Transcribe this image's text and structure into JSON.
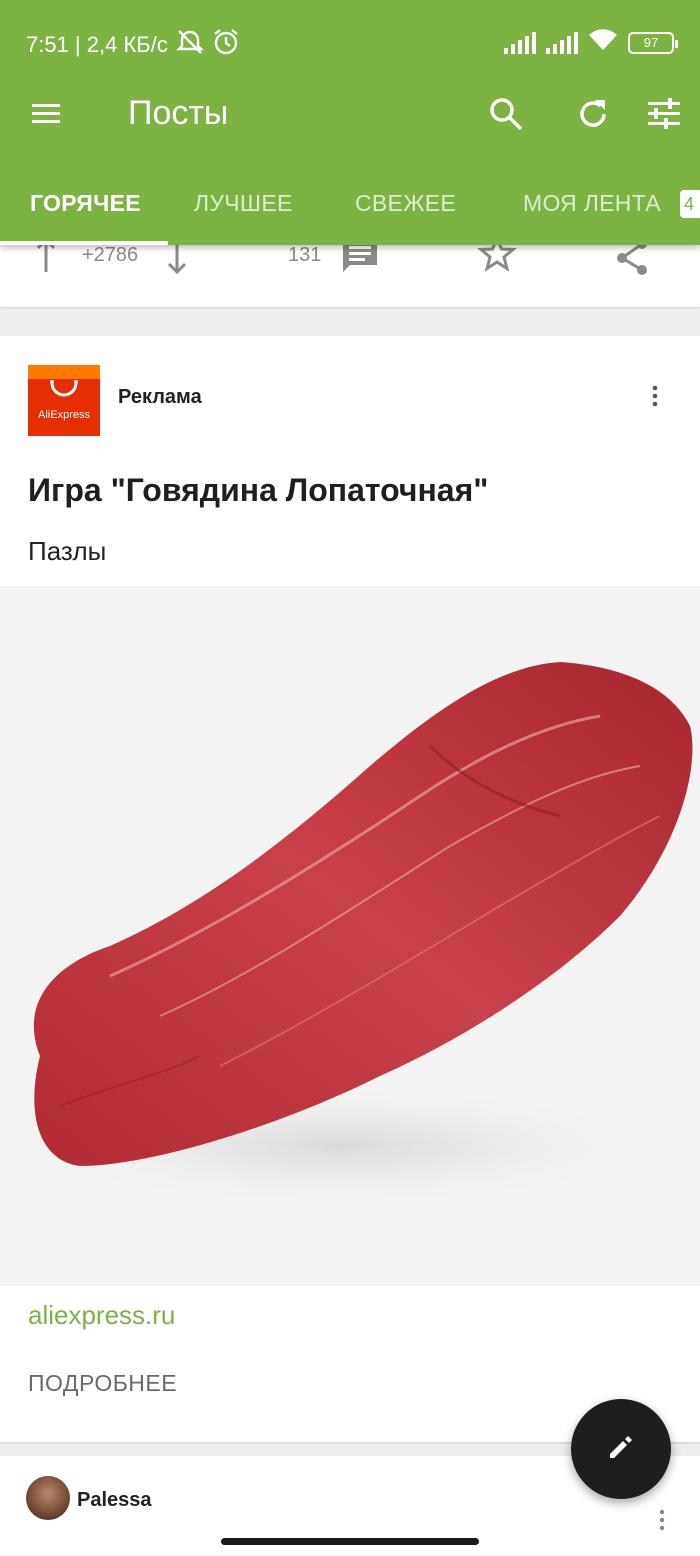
{
  "status_bar": {
    "time_and_speed": "7:51 | 2,4 КБ/с",
    "battery": "97"
  },
  "toolbar": {
    "title": "Посты"
  },
  "tabs": [
    {
      "label": "ГОРЯЧЕЕ",
      "active": true
    },
    {
      "label": "ЛУЧШЕЕ",
      "active": false
    },
    {
      "label": "СВЕЖЕЕ",
      "active": false
    },
    {
      "label": "МОЯ ЛЕНТА",
      "active": false
    }
  ],
  "tab_badge": "4",
  "previous_post": {
    "rating": "+2786",
    "comments": "131"
  },
  "ad_post": {
    "logo_text": "AliExpress",
    "sponsor_label": "Реклама",
    "title": "Игра \"Говядина Лопаточная\"",
    "subtitle": "Пазлы",
    "link": "aliexpress.ru",
    "more_label": "ПОДРОБНЕЕ"
  },
  "next_post": {
    "author": "Palessa"
  },
  "colors": {
    "accent": "#7cb342",
    "fab": "#1e1e1e",
    "meat": "#b8323b"
  },
  "icons": [
    "menu-icon",
    "search-icon",
    "refresh-icon",
    "filter-icon",
    "arrow-up-icon",
    "arrow-down-icon",
    "comment-icon",
    "star-icon",
    "share-icon",
    "more-vert-icon",
    "edit-icon"
  ]
}
